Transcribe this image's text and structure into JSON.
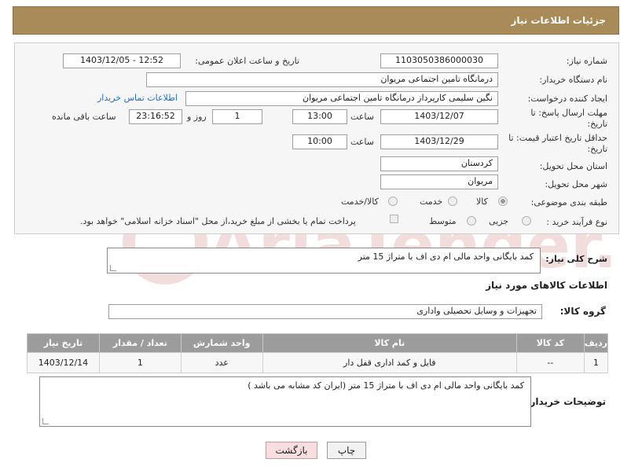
{
  "header": {
    "title": "جزئیات اطلاعات نیاز"
  },
  "form": {
    "need_number_label": "شماره نیاز:",
    "need_number": "1103050386000030",
    "announce_label": "تاریخ و ساعت اعلان عمومی:",
    "announce_value": "1403/12/05 - 12:52",
    "buyer_org_label": "نام دستگاه خریدار:",
    "buyer_org": "درمانگاه تامین اجتماعی مریوان",
    "requester_label": "ایجاد کننده درخواست:",
    "requester": "نگین سلیمی کارپرداز درمانگاه تامین اجتماعی مریوان",
    "buyer_contact_link": "اطلاعات تماس خریدار",
    "deadline_label_1": "مهلت ارسال پاسخ: تا",
    "deadline_label_2": "تاریخ:",
    "deadline_date": "1403/12/07",
    "time_label": "ساعت",
    "deadline_time": "13:00",
    "day_count": "1",
    "day_and_label": "روز و",
    "remaining_time": "23:16:52",
    "remaining_label": "ساعت باقی مانده",
    "validity_label_1": "حداقل تاریخ اعتبار قیمت: تا",
    "validity_label_2": "تاریخ:",
    "validity_date": "1403/12/29",
    "validity_time": "10:00",
    "province_label": "استان محل تحویل:",
    "province": "کردستان",
    "city_label": "شهر محل تحویل:",
    "city": "مریوان",
    "category_label": "طبقه بندی موضوعی:",
    "category_options": [
      "کالا",
      "خدمت",
      "کالا/خدمت"
    ],
    "category_selected": "کالا",
    "process_label": "نوع فرآیند خرید :",
    "process_options": [
      "جزیی",
      "متوسط"
    ],
    "payment_note": "پرداخت تمام یا بخشی از مبلغ خرید،از محل \"اسناد خزانه اسلامی\" خواهد بود."
  },
  "description": {
    "label": "شرح کلی نیاز:",
    "text": "کمد بایگانی واحد مالی ام دی اف با متراژ 15 متر"
  },
  "goods_info": {
    "title": "اطلاعات کالاهای مورد نیاز",
    "group_label": "گروه کالا:",
    "group_value": "تجهیزات و وسایل تحصیلی واداری"
  },
  "table": {
    "headers": [
      "ردیف",
      "کد کالا",
      "نام کالا",
      "واحد شمارش",
      "تعداد / مقدار",
      "تاریخ نیاز"
    ],
    "rows": [
      [
        "1",
        "--",
        "فایل و کمد اداری قفل دار",
        "عدد",
        "1",
        "1403/12/14"
      ]
    ]
  },
  "buyer_notes": {
    "label": "توضیحات خریدار:",
    "text": "کمد بایگانی واحد مالی ام دی اف با متراژ 15 متر (ایران کد مشابه می باشد )"
  },
  "buttons": {
    "print": "چاپ",
    "back": "بازگشت"
  },
  "watermark": {
    "text": "AriaTender.net"
  },
  "colors": {
    "header_bg": "#a98b59",
    "table_header_bg": "#9c9c9c",
    "link": "#1f6fd0",
    "back_button_bg": "#f8dede"
  }
}
